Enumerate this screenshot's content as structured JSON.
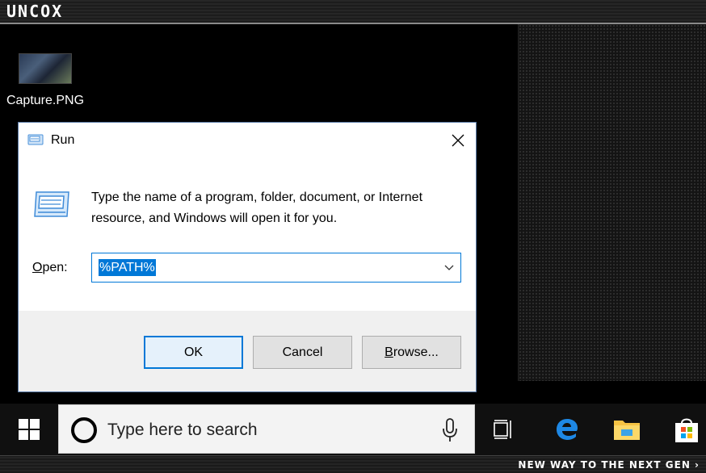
{
  "brand": {
    "name": "UNCOX"
  },
  "desktop": {
    "icons": [
      {
        "label": "Capture.PNG",
        "icon": "image-thumbnail-icon"
      }
    ]
  },
  "run_dialog": {
    "title": "Run",
    "description": "Type the name of a program, folder, document, or Internet resource, and Windows will open it for you.",
    "open_label_underlined": "O",
    "open_label_rest": "pen:",
    "open_value": "%PATH%",
    "buttons": {
      "ok": "OK",
      "cancel": "Cancel",
      "browse_underlined": "B",
      "browse_rest": "rowse..."
    },
    "accent_color": "#0078d7"
  },
  "taskbar": {
    "search_placeholder": "Type here to search",
    "icons": [
      "windows-start-icon",
      "cortana-circle-icon",
      "microphone-icon",
      "task-view-icon",
      "edge-browser-icon",
      "file-explorer-icon",
      "store-icon"
    ]
  },
  "footer": {
    "tagline": "NEW WAY TO THE NEXT GEN ›"
  }
}
